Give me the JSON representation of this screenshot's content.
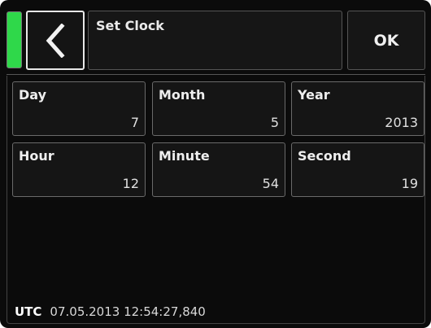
{
  "header": {
    "title": "Set Clock",
    "ok_label": "OK",
    "status_color": "#2fd84a"
  },
  "fields": {
    "day": {
      "label": "Day",
      "value": "7"
    },
    "month": {
      "label": "Month",
      "value": "5"
    },
    "year": {
      "label": "Year",
      "value": "2013"
    },
    "hour": {
      "label": "Hour",
      "value": "12"
    },
    "minute": {
      "label": "Minute",
      "value": "54"
    },
    "second": {
      "label": "Second",
      "value": "19"
    }
  },
  "footer": {
    "utc_label": "UTC",
    "utc_value": "07.05.2013 12:54:27,840"
  },
  "icons": {
    "back": "chevron-left-icon"
  }
}
